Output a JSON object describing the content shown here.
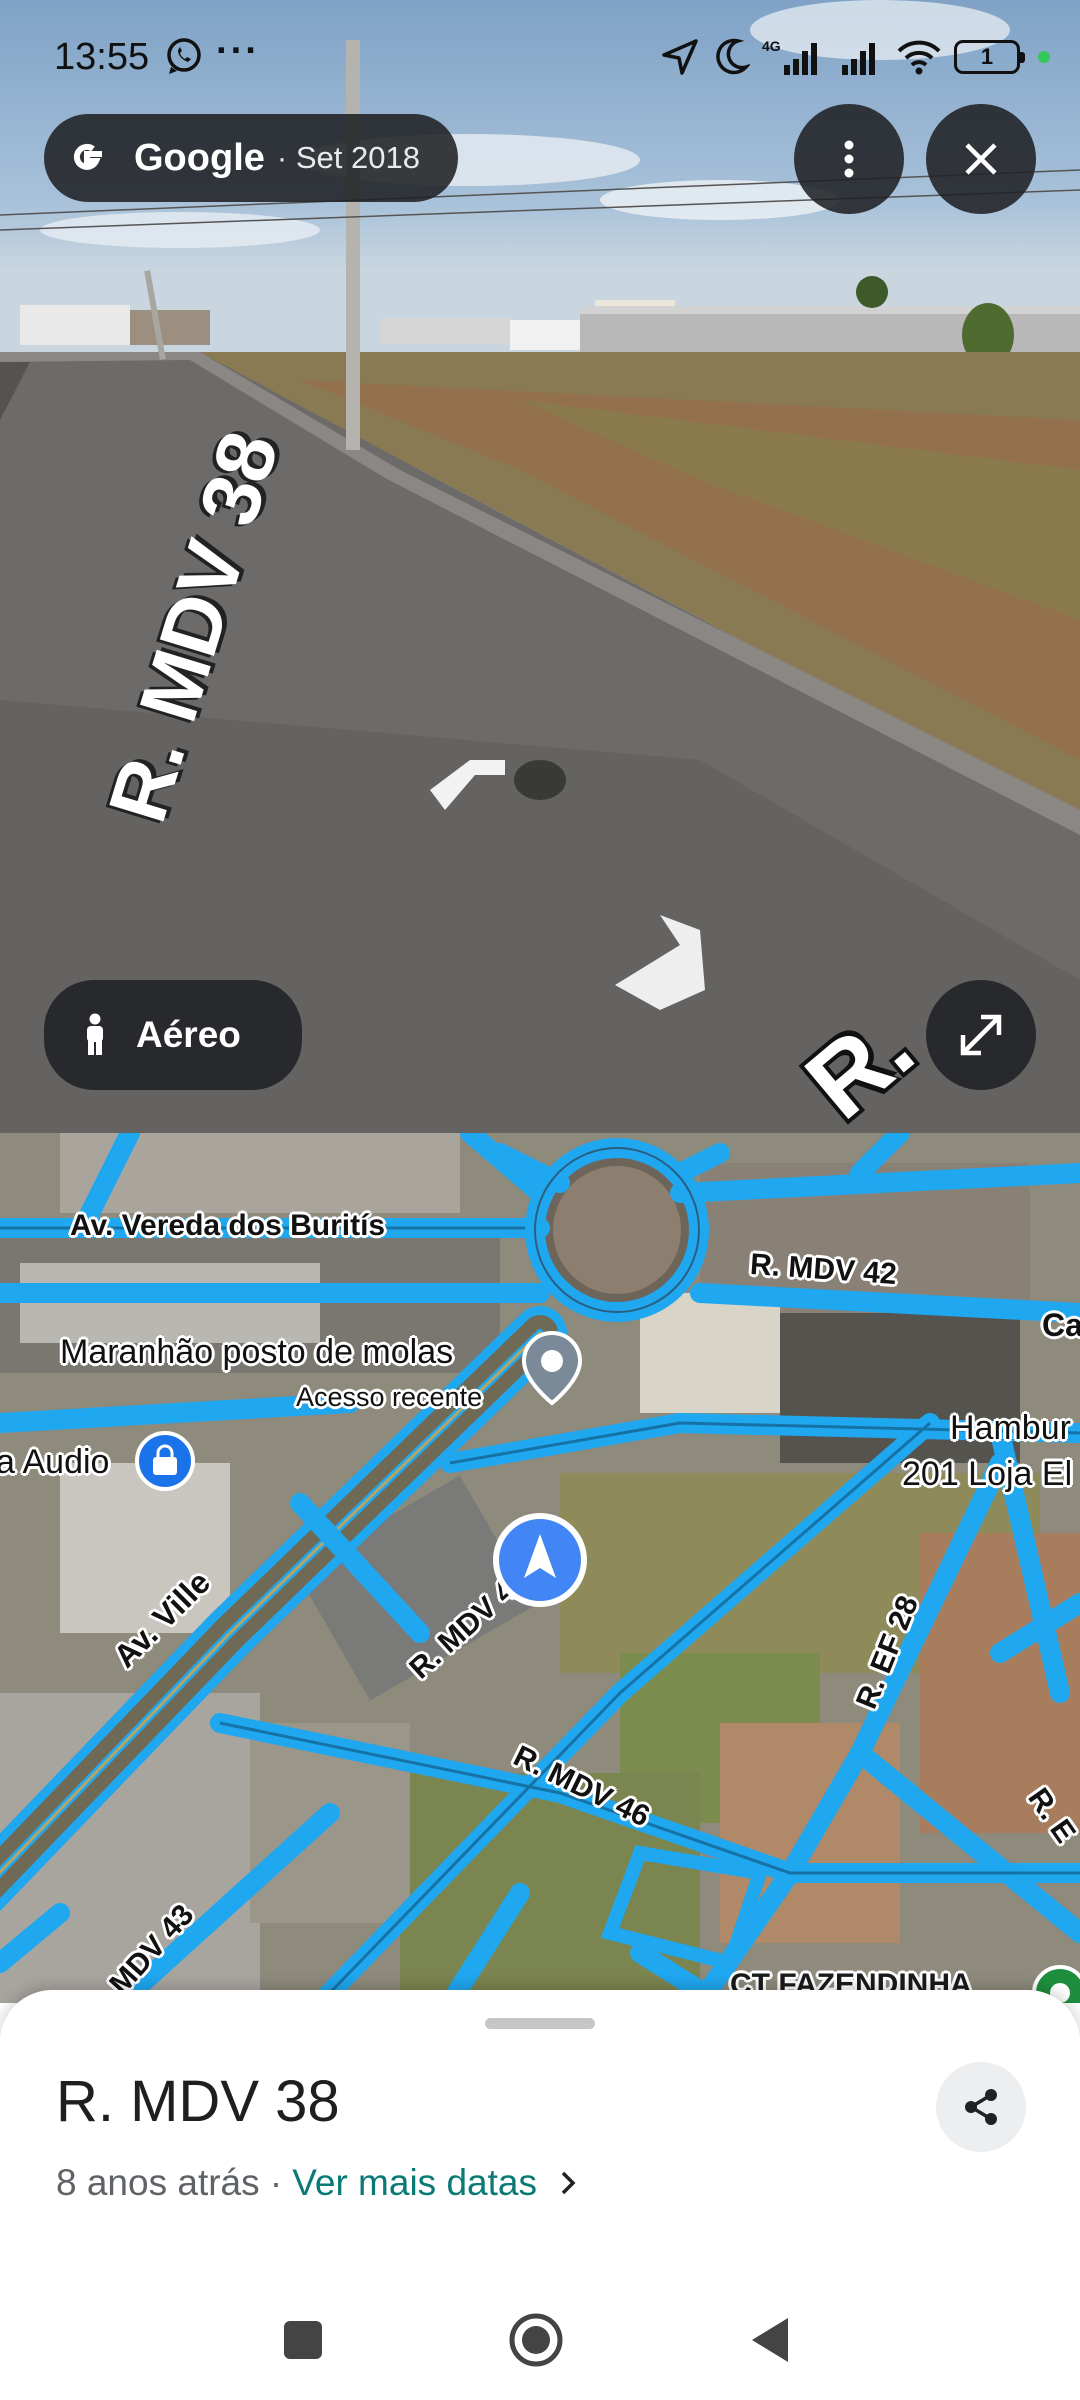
{
  "status_bar": {
    "time": "13:55",
    "dots": "···",
    "network": "4G",
    "battery_level": "1"
  },
  "streetview": {
    "brand": "Google",
    "capture_date": "· Set 2018",
    "aerial_button_label": "Aéreo",
    "street_label_left": "R. MDV 38",
    "street_label_right": "R."
  },
  "map": {
    "roads": {
      "av_vereda": "Av. Vereda dos Buritís",
      "mdv42": "R. MDV 42",
      "av_ville": "Av. Ville",
      "mdv_center": "R. MDV 4",
      "mdv46": "R. MDV 46",
      "mdv43": "MDV 43",
      "ef28": "R. EF 28",
      "r_e": "R. E",
      "ca": "Ca",
      "ct": "CT FAZENDINHA"
    },
    "places": {
      "maranhao_name": "Maranhão posto de molas",
      "maranhao_sub": "Acesso recente",
      "audio": "a Audio",
      "hamburg_1": "Hambur",
      "hamburg_2": "201 Loja El"
    }
  },
  "sheet": {
    "title": "R. MDV 38",
    "age": "8 anos atrás ·",
    "more_dates": "Ver mais datas"
  },
  "colors": {
    "road_blue": "#1fa7f0",
    "pin_blue": "#4285f4",
    "link_teal": "#0b7a75",
    "pill_dark": "#202124"
  }
}
